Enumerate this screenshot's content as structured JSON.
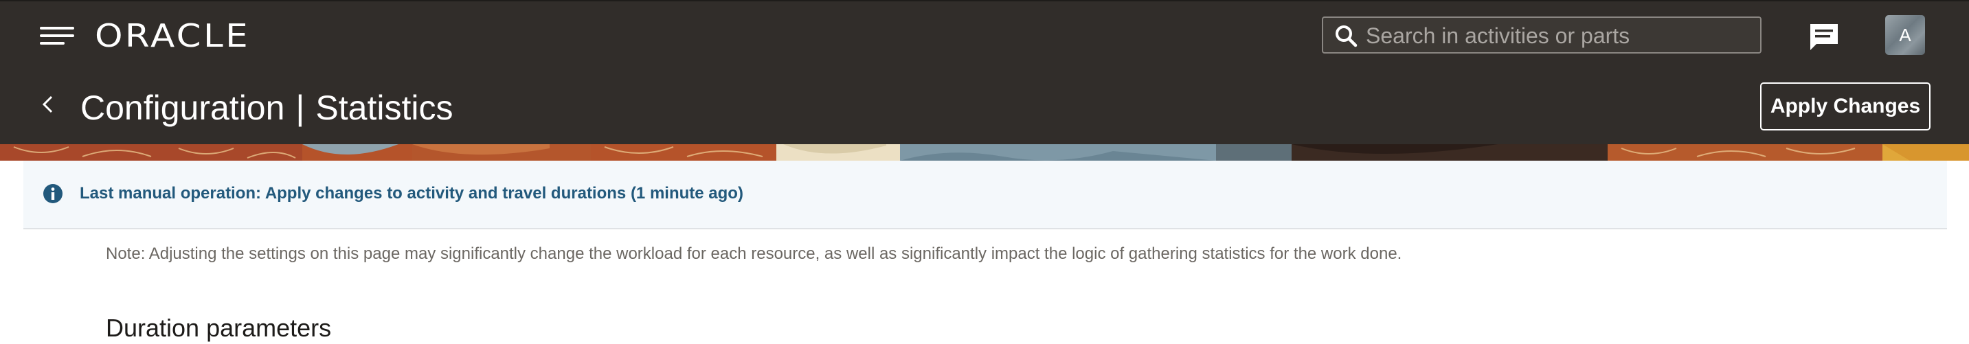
{
  "app": {
    "logo_text": "ORACLE"
  },
  "header": {
    "search_placeholder": "Search in activities or parts",
    "avatar_initial": "A",
    "title_main": "Configuration",
    "title_separator": "|",
    "title_sub": "Statistics",
    "apply_button_label": "Apply Changes"
  },
  "info_bar": {
    "message": "Last manual operation: Apply changes to activity and travel durations (1 minute ago)"
  },
  "content": {
    "note": "Note: Adjusting the settings on this page may significantly change the workload for each resource, as well as significantly impact the logic of gathering statistics for the work done.",
    "section_title": "Duration parameters"
  },
  "icons": {
    "menu": "hamburger-menu-icon",
    "search": "search-icon",
    "chat": "chat-icon",
    "back": "chevron-left-icon",
    "info": "info-icon"
  },
  "colors": {
    "header_bg": "#312d2a",
    "info_bg": "#f4f8fb",
    "info_text": "#22597c",
    "accent_banner": "#b5532a"
  }
}
